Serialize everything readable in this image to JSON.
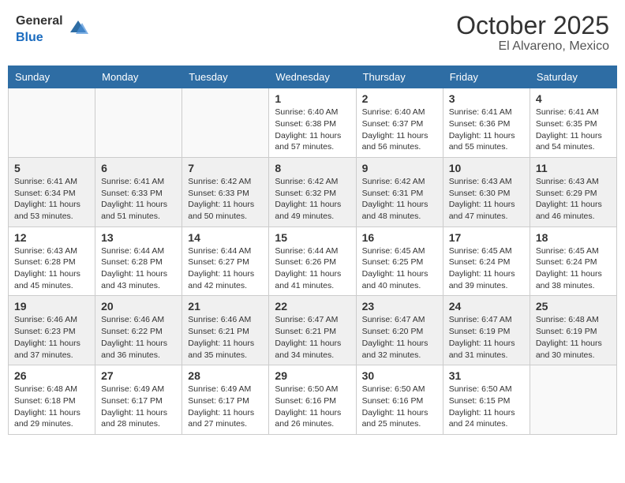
{
  "header": {
    "logo_general": "General",
    "logo_blue": "Blue",
    "month": "October 2025",
    "location": "El Alvareno, Mexico"
  },
  "weekdays": [
    "Sunday",
    "Monday",
    "Tuesday",
    "Wednesday",
    "Thursday",
    "Friday",
    "Saturday"
  ],
  "weeks": [
    [
      {
        "day": "",
        "info": ""
      },
      {
        "day": "",
        "info": ""
      },
      {
        "day": "",
        "info": ""
      },
      {
        "day": "1",
        "info": "Sunrise: 6:40 AM\nSunset: 6:38 PM\nDaylight: 11 hours and 57 minutes."
      },
      {
        "day": "2",
        "info": "Sunrise: 6:40 AM\nSunset: 6:37 PM\nDaylight: 11 hours and 56 minutes."
      },
      {
        "day": "3",
        "info": "Sunrise: 6:41 AM\nSunset: 6:36 PM\nDaylight: 11 hours and 55 minutes."
      },
      {
        "day": "4",
        "info": "Sunrise: 6:41 AM\nSunset: 6:35 PM\nDaylight: 11 hours and 54 minutes."
      }
    ],
    [
      {
        "day": "5",
        "info": "Sunrise: 6:41 AM\nSunset: 6:34 PM\nDaylight: 11 hours and 53 minutes."
      },
      {
        "day": "6",
        "info": "Sunrise: 6:41 AM\nSunset: 6:33 PM\nDaylight: 11 hours and 51 minutes."
      },
      {
        "day": "7",
        "info": "Sunrise: 6:42 AM\nSunset: 6:33 PM\nDaylight: 11 hours and 50 minutes."
      },
      {
        "day": "8",
        "info": "Sunrise: 6:42 AM\nSunset: 6:32 PM\nDaylight: 11 hours and 49 minutes."
      },
      {
        "day": "9",
        "info": "Sunrise: 6:42 AM\nSunset: 6:31 PM\nDaylight: 11 hours and 48 minutes."
      },
      {
        "day": "10",
        "info": "Sunrise: 6:43 AM\nSunset: 6:30 PM\nDaylight: 11 hours and 47 minutes."
      },
      {
        "day": "11",
        "info": "Sunrise: 6:43 AM\nSunset: 6:29 PM\nDaylight: 11 hours and 46 minutes."
      }
    ],
    [
      {
        "day": "12",
        "info": "Sunrise: 6:43 AM\nSunset: 6:28 PM\nDaylight: 11 hours and 45 minutes."
      },
      {
        "day": "13",
        "info": "Sunrise: 6:44 AM\nSunset: 6:28 PM\nDaylight: 11 hours and 43 minutes."
      },
      {
        "day": "14",
        "info": "Sunrise: 6:44 AM\nSunset: 6:27 PM\nDaylight: 11 hours and 42 minutes."
      },
      {
        "day": "15",
        "info": "Sunrise: 6:44 AM\nSunset: 6:26 PM\nDaylight: 11 hours and 41 minutes."
      },
      {
        "day": "16",
        "info": "Sunrise: 6:45 AM\nSunset: 6:25 PM\nDaylight: 11 hours and 40 minutes."
      },
      {
        "day": "17",
        "info": "Sunrise: 6:45 AM\nSunset: 6:24 PM\nDaylight: 11 hours and 39 minutes."
      },
      {
        "day": "18",
        "info": "Sunrise: 6:45 AM\nSunset: 6:24 PM\nDaylight: 11 hours and 38 minutes."
      }
    ],
    [
      {
        "day": "19",
        "info": "Sunrise: 6:46 AM\nSunset: 6:23 PM\nDaylight: 11 hours and 37 minutes."
      },
      {
        "day": "20",
        "info": "Sunrise: 6:46 AM\nSunset: 6:22 PM\nDaylight: 11 hours and 36 minutes."
      },
      {
        "day": "21",
        "info": "Sunrise: 6:46 AM\nSunset: 6:21 PM\nDaylight: 11 hours and 35 minutes."
      },
      {
        "day": "22",
        "info": "Sunrise: 6:47 AM\nSunset: 6:21 PM\nDaylight: 11 hours and 34 minutes."
      },
      {
        "day": "23",
        "info": "Sunrise: 6:47 AM\nSunset: 6:20 PM\nDaylight: 11 hours and 32 minutes."
      },
      {
        "day": "24",
        "info": "Sunrise: 6:47 AM\nSunset: 6:19 PM\nDaylight: 11 hours and 31 minutes."
      },
      {
        "day": "25",
        "info": "Sunrise: 6:48 AM\nSunset: 6:19 PM\nDaylight: 11 hours and 30 minutes."
      }
    ],
    [
      {
        "day": "26",
        "info": "Sunrise: 6:48 AM\nSunset: 6:18 PM\nDaylight: 11 hours and 29 minutes."
      },
      {
        "day": "27",
        "info": "Sunrise: 6:49 AM\nSunset: 6:17 PM\nDaylight: 11 hours and 28 minutes."
      },
      {
        "day": "28",
        "info": "Sunrise: 6:49 AM\nSunset: 6:17 PM\nDaylight: 11 hours and 27 minutes."
      },
      {
        "day": "29",
        "info": "Sunrise: 6:50 AM\nSunset: 6:16 PM\nDaylight: 11 hours and 26 minutes."
      },
      {
        "day": "30",
        "info": "Sunrise: 6:50 AM\nSunset: 6:16 PM\nDaylight: 11 hours and 25 minutes."
      },
      {
        "day": "31",
        "info": "Sunrise: 6:50 AM\nSunset: 6:15 PM\nDaylight: 11 hours and 24 minutes."
      },
      {
        "day": "",
        "info": ""
      }
    ]
  ]
}
